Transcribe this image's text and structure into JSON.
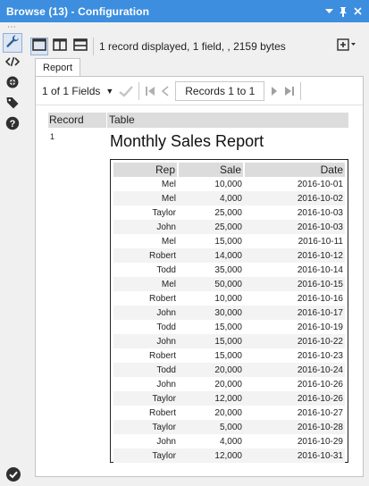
{
  "window": {
    "title": "Browse (13) - Configuration",
    "dropdown_icon": "chevron-down-icon",
    "pin_icon": "pin-icon",
    "close_icon": "close-icon"
  },
  "toolbar": {
    "info": "1 record displayed, 1 field, , 2159 bytes"
  },
  "tabs": [
    {
      "label": "Report"
    }
  ],
  "nav": {
    "fields": "1 of 1 Fields",
    "records": "Records 1 to 1"
  },
  "grid": {
    "columns": [
      "Record",
      "Table"
    ],
    "record_number": "1",
    "report_title": "Monthly Sales Report"
  },
  "report": {
    "columns": [
      "Rep",
      "Sale",
      "Date"
    ],
    "rows": [
      [
        "Mel",
        "10,000",
        "2016-10-01"
      ],
      [
        "Mel",
        "4,000",
        "2016-10-02"
      ],
      [
        "Taylor",
        "25,000",
        "2016-10-03"
      ],
      [
        "John",
        "25,000",
        "2016-10-03"
      ],
      [
        "Mel",
        "15,000",
        "2016-10-11"
      ],
      [
        "Robert",
        "14,000",
        "2016-10-12"
      ],
      [
        "Todd",
        "35,000",
        "2016-10-14"
      ],
      [
        "Mel",
        "50,000",
        "2016-10-15"
      ],
      [
        "Robert",
        "10,000",
        "2016-10-16"
      ],
      [
        "John",
        "30,000",
        "2016-10-17"
      ],
      [
        "Todd",
        "15,000",
        "2016-10-19"
      ],
      [
        "John",
        "15,000",
        "2016-10-22"
      ],
      [
        "Robert",
        "15,000",
        "2016-10-23"
      ],
      [
        "Todd",
        "20,000",
        "2016-10-24"
      ],
      [
        "John",
        "20,000",
        "2016-10-26"
      ],
      [
        "Taylor",
        "12,000",
        "2016-10-26"
      ],
      [
        "Robert",
        "20,000",
        "2016-10-27"
      ],
      [
        "Taylor",
        "5,000",
        "2016-10-28"
      ],
      [
        "John",
        "4,000",
        "2016-10-29"
      ],
      [
        "Taylor",
        "12,000",
        "2016-10-31"
      ]
    ]
  },
  "colors": {
    "titlebar": "#3d8ede",
    "accent": "#2e75b6",
    "help": "#2f2f2f"
  }
}
